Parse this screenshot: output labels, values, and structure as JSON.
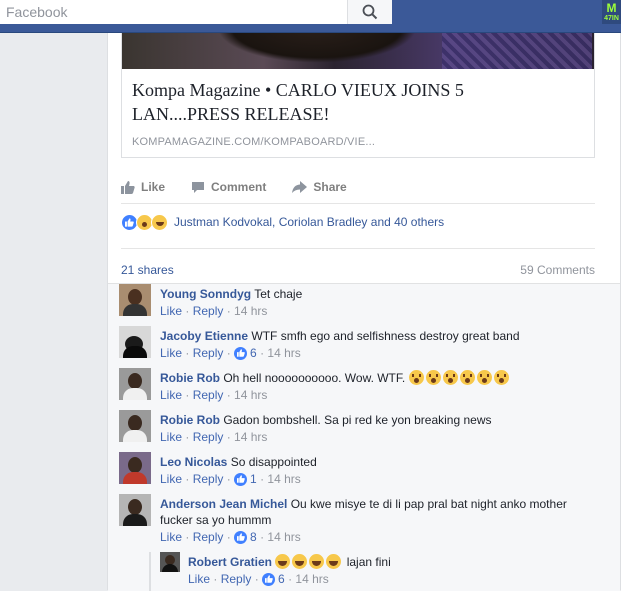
{
  "search": {
    "placeholder": "Facebook"
  },
  "corner_badge": {
    "line1": "M",
    "line2": "47IN"
  },
  "post": {
    "link_title": "Kompa Magazine • CARLO VIEUX JOINS 5 LAN....PRESS RELEASE!",
    "link_domain": "KOMPAMAGAZINE.COM/KOMPABOARD/VIE...",
    "actions": {
      "like": "Like",
      "comment": "Comment",
      "share": "Share"
    },
    "reactions_text": "Justman Kodvokal, Coriolan Bradley and 40 others",
    "shares": "21 shares",
    "comments_count": "59 Comments"
  },
  "comments": [
    {
      "name": "Young Sonndyg",
      "text": "Tet chaje",
      "like": "Like",
      "reply": "Reply",
      "likes": "",
      "time": "14 hrs"
    },
    {
      "name": "Jacoby Etienne",
      "text": "WTF smfh ego and selfishness destroy great band",
      "like": "Like",
      "reply": "Reply",
      "likes": "6",
      "time": "14 hrs"
    },
    {
      "name": "Robie Rob",
      "text": "Oh hell noooooooooo. Wow. WTF.",
      "like": "Like",
      "reply": "Reply",
      "likes": "",
      "time": "14 hrs"
    },
    {
      "name": "Robie Rob",
      "text": "Gadon bombshell. Sa pi red ke yon breaking news",
      "like": "Like",
      "reply": "Reply",
      "likes": "",
      "time": "14 hrs"
    },
    {
      "name": "Leo Nicolas",
      "text": "So disappointed",
      "like": "Like",
      "reply": "Reply",
      "likes": "1",
      "time": "14 hrs"
    },
    {
      "name": "Anderson Jean Michel",
      "text": "Ou kwe misye te di li pap pral bat night anko mother fucker sa yo hummm",
      "like": "Like",
      "reply": "Reply",
      "likes": "8",
      "time": "14 hrs"
    }
  ],
  "reply": {
    "name": "Robert Gratien",
    "text": "lajan fini",
    "like": "Like",
    "reply": "Reply",
    "likes": "6",
    "time": "14 hrs"
  },
  "colors": {
    "brand": "#3b5998",
    "link": "#365899",
    "like_blue": "#4080ff"
  }
}
